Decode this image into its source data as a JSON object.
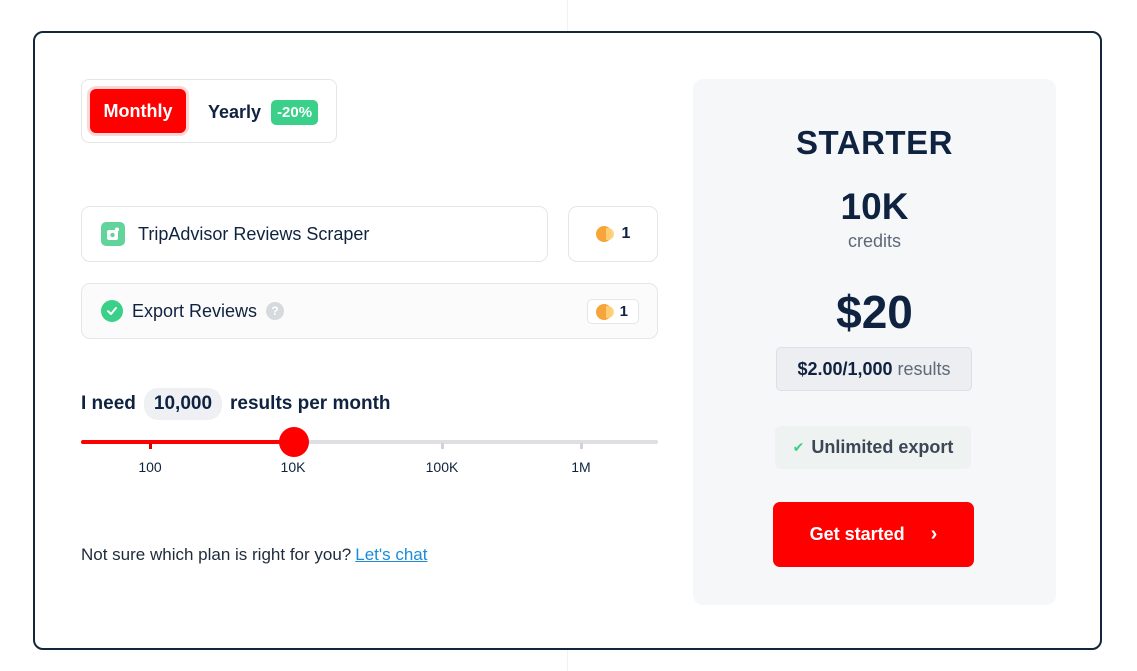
{
  "billing": {
    "monthly_label": "Monthly",
    "yearly_label": "Yearly",
    "yearly_discount": "-20%"
  },
  "actor": {
    "name": "TripAdvisor Reviews Scraper",
    "credits": "1"
  },
  "addon": {
    "name": "Export Reviews",
    "help": "?",
    "credits": "1"
  },
  "need": {
    "prefix": "I need",
    "value": "10,000",
    "suffix": "results per month"
  },
  "slider": {
    "level": 0.37,
    "ticks": [
      "100",
      "10K",
      "100K",
      "1M"
    ]
  },
  "help_text": {
    "question": "Not sure which plan is right for you?",
    "link_label": "Let's chat"
  },
  "plan": {
    "name": "STARTER",
    "credits": "10K",
    "credits_label": "credits",
    "price": "$20",
    "unit_price": "$2.00/1,000",
    "unit_label": "results",
    "feature": "Unlimited export",
    "cta_label": "Get started"
  },
  "colors": {
    "accent": "#ff0000",
    "success": "#3ad08a",
    "text": "#0f2340",
    "coin": "#f6a53a"
  },
  "icons": [
    "app-icon",
    "coin-icon",
    "check-circle-icon",
    "help-icon",
    "check-icon",
    "chevron-right-icon"
  ]
}
